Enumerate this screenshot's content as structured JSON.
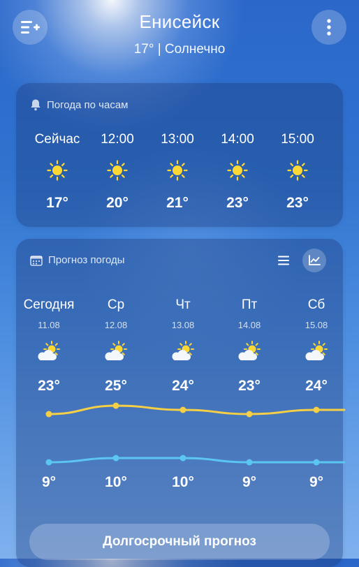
{
  "header": {
    "city": "Енисейск",
    "current": "17° | Солнечно"
  },
  "hourly": {
    "title": "Погода по часам",
    "items": [
      {
        "time": "Сейчас",
        "icon": "sun-icon",
        "temp": "17°"
      },
      {
        "time": "12:00",
        "icon": "sun-icon",
        "temp": "20°"
      },
      {
        "time": "13:00",
        "icon": "sun-icon",
        "temp": "21°"
      },
      {
        "time": "14:00",
        "icon": "sun-icon",
        "temp": "23°"
      },
      {
        "time": "15:00",
        "icon": "sun-icon",
        "temp": "23°"
      }
    ]
  },
  "forecast": {
    "title": "Прогноз погоды",
    "days": [
      {
        "name": "Сегодня",
        "date": "11.08",
        "icon": "partly-cloudy-icon",
        "high": "23°",
        "low": "9°",
        "high_value": 23,
        "low_value": 9
      },
      {
        "name": "Ср",
        "date": "12.08",
        "icon": "partly-cloudy-icon",
        "high": "25°",
        "low": "10°",
        "high_value": 25,
        "low_value": 10
      },
      {
        "name": "Чт",
        "date": "13.08",
        "icon": "partly-cloudy-icon",
        "high": "24°",
        "low": "10°",
        "high_value": 24,
        "low_value": 10
      },
      {
        "name": "Пт",
        "date": "14.08",
        "icon": "partly-cloudy-icon",
        "high": "23°",
        "low": "9°",
        "high_value": 23,
        "low_value": 9
      },
      {
        "name": "Сб",
        "date": "15.08",
        "icon": "partly-cloudy-icon",
        "high": "24°",
        "low": "9°",
        "high_value": 24,
        "low_value": 9
      }
    ],
    "long_range_label": "Долгосрочный прогноз"
  },
  "colors": {
    "high_line": "#f5cf45",
    "low_line": "#5cc6f2",
    "sun": "#fdd835"
  }
}
